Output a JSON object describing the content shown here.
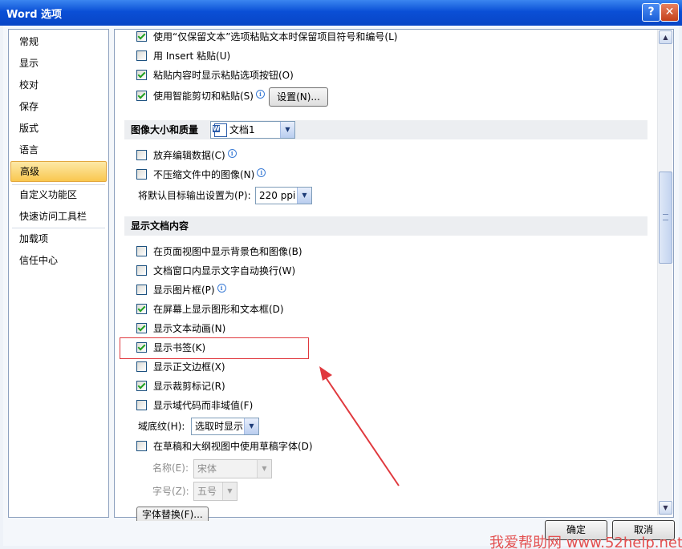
{
  "window": {
    "title": "Word 选项",
    "help_icon": "?",
    "close_icon": "✕"
  },
  "nav": {
    "items": [
      {
        "label": "常规"
      },
      {
        "label": "显示"
      },
      {
        "label": "校对"
      },
      {
        "label": "保存"
      },
      {
        "label": "版式"
      },
      {
        "label": "语言"
      },
      {
        "label": "高级",
        "selected": true
      },
      {
        "label": "自定义功能区"
      },
      {
        "label": "快速访问工具栏"
      },
      {
        "label": "加载项"
      },
      {
        "label": "信任中心"
      }
    ]
  },
  "paste_options": {
    "opt1": {
      "label": "使用“仅保留文本”选项粘贴文本时保留项目符号和编号(L)",
      "checked": true
    },
    "opt2": {
      "label": "用 Insert 粘贴(U)",
      "checked": false
    },
    "opt3": {
      "label": "粘贴内容时显示粘贴选项按钮(O)",
      "checked": true
    },
    "opt4": {
      "label": "使用智能剪切和粘贴(S)",
      "checked": true
    },
    "settings_button": "设置(N)..."
  },
  "image_section": {
    "title": "图像大小和质量",
    "doc_select": "文档1",
    "opt1": {
      "label": "放弃编辑数据(C)",
      "checked": false
    },
    "opt2": {
      "label": "不压缩文件中的图像(N)",
      "checked": false
    },
    "resolution_label": "将默认目标输出设置为(P):",
    "resolution_value": "220 ppi"
  },
  "display_section": {
    "title": "显示文档内容",
    "opt1": {
      "label": "在页面视图中显示背景色和图像(B)",
      "checked": false
    },
    "opt2": {
      "label": "文档窗口内显示文字自动换行(W)",
      "checked": false
    },
    "opt3": {
      "label": "显示图片框(P)",
      "checked": false
    },
    "opt4": {
      "label": "在屏幕上显示图形和文本框(D)",
      "checked": true
    },
    "opt5": {
      "label": "显示文本动画(N)",
      "checked": true
    },
    "opt6": {
      "label": "显示书签(K)",
      "checked": true
    },
    "opt7": {
      "label": "显示正文边框(X)",
      "checked": false
    },
    "opt8": {
      "label": "显示裁剪标记(R)",
      "checked": true
    },
    "opt9": {
      "label": "显示域代码而非域值(F)",
      "checked": false
    },
    "shading_label": "域底纹(H):",
    "shading_value": "选取时显示",
    "opt10": {
      "label": "在草稿和大纲视图中使用草稿字体(D)",
      "checked": false
    },
    "font_name_label": "名称(E):",
    "font_name_value": "宋体",
    "font_size_label": "字号(Z):",
    "font_size_value": "五号",
    "partial_button": "字体替换(F)..."
  },
  "footer": {
    "ok": "确定",
    "cancel": "取消"
  },
  "watermark": "我爱帮助网 www.52help.net",
  "colors": {
    "titlebar": "#0a4fd6",
    "selected_nav": "#f9c74f",
    "highlight_box": "#e0393e"
  }
}
